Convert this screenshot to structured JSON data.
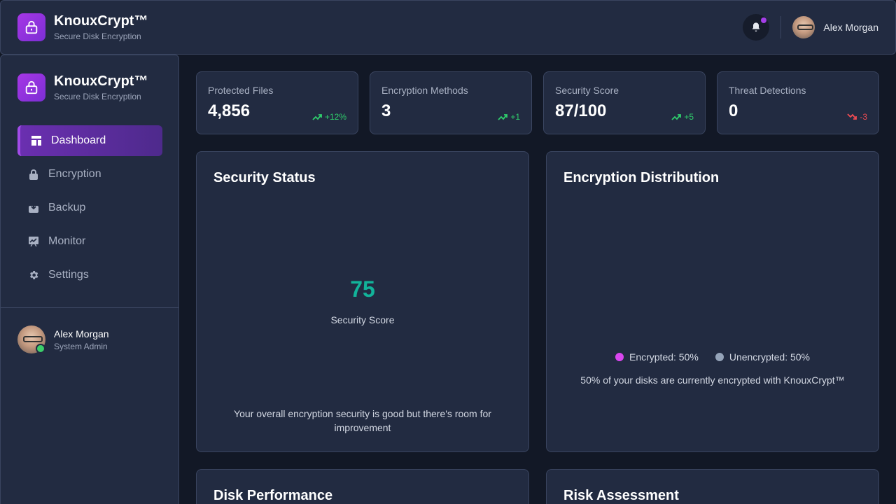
{
  "app": {
    "name": "KnouxCrypt™",
    "subtitle": "Secure Disk Encryption"
  },
  "header": {
    "user_name": "Alex Morgan",
    "notification_icon": "bell-icon"
  },
  "sidebar": {
    "items": [
      {
        "label": "Dashboard",
        "icon": "dashboard-icon",
        "active": true
      },
      {
        "label": "Encryption",
        "icon": "lock-icon",
        "active": false
      },
      {
        "label": "Backup",
        "icon": "backup-icon",
        "active": false
      },
      {
        "label": "Monitor",
        "icon": "monitor-icon",
        "active": false
      },
      {
        "label": "Settings",
        "icon": "gear-icon",
        "active": false
      }
    ],
    "user": {
      "name": "Alex Morgan",
      "role": "System Admin",
      "status": "online"
    }
  },
  "stats": [
    {
      "label": "Protected Files",
      "value": "4,856",
      "change": "+12%",
      "trend": "up"
    },
    {
      "label": "Encryption Methods",
      "value": "3",
      "change": "+1",
      "trend": "up"
    },
    {
      "label": "Security Score",
      "value": "87/100",
      "change": "+5",
      "trend": "up"
    },
    {
      "label": "Threat Detections",
      "value": "0",
      "change": "-3",
      "trend": "down"
    }
  ],
  "security_status": {
    "title": "Security Status",
    "score": "75",
    "score_label": "Security Score",
    "note": "Your overall encryption security is good but there's room for improvement"
  },
  "encryption_distribution": {
    "title": "Encryption Distribution",
    "legend": [
      {
        "label": "Encrypted: 50%",
        "color": "#d946ef"
      },
      {
        "label": "Unencrypted: 50%",
        "color": "#94a3b8"
      }
    ],
    "note": "50% of your disks are currently encrypted with KnouxCrypt™"
  },
  "disk_performance": {
    "title": "Disk Performance"
  },
  "risk_assessment": {
    "title": "Risk Assessment"
  },
  "colors": {
    "accent": "#a637e6",
    "success": "#2fcf6c",
    "danger": "#ef4b52",
    "score": "#12b39a"
  }
}
